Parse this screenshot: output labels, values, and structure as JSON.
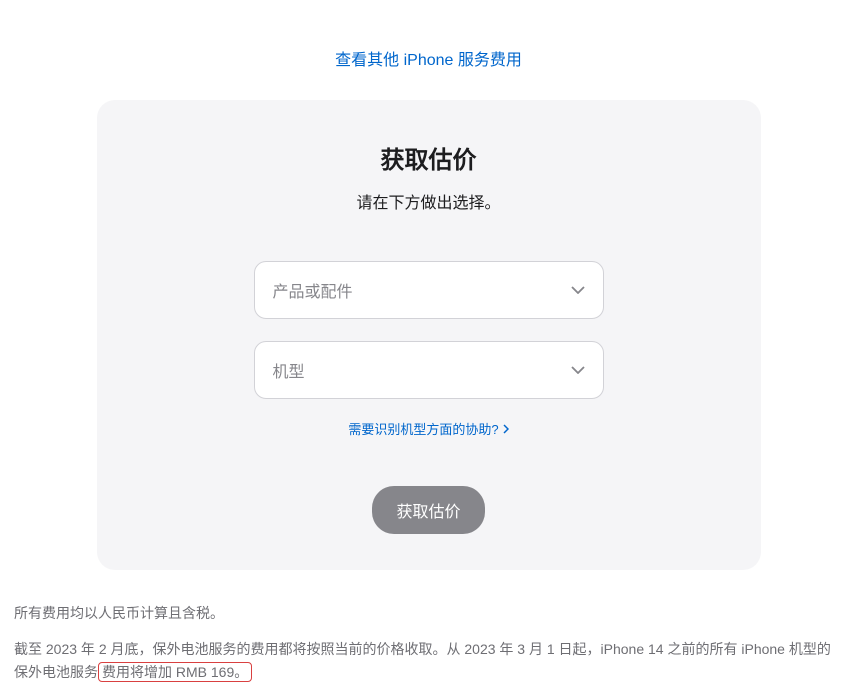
{
  "topLink": {
    "label": "查看其他 iPhone 服务费用"
  },
  "card": {
    "title": "获取估价",
    "subtitle": "请在下方做出选择。",
    "select1": {
      "placeholder": "产品或配件"
    },
    "select2": {
      "placeholder": "机型"
    },
    "helpLink": {
      "label": "需要识别机型方面的协助?"
    },
    "submitButton": {
      "label": "获取估价"
    }
  },
  "footer": {
    "note1": "所有费用均以人民币计算且含税。",
    "note2_part1": "截至 2023 年 2 月底，保外电池服务的费用都将按照当前的价格收取。从 2023 年 3 月 1 日起，iPhone 14 之前的所有 iPhone 机型的保外电池服务",
    "note2_highlight": "费用将增加 RMB 169。"
  }
}
